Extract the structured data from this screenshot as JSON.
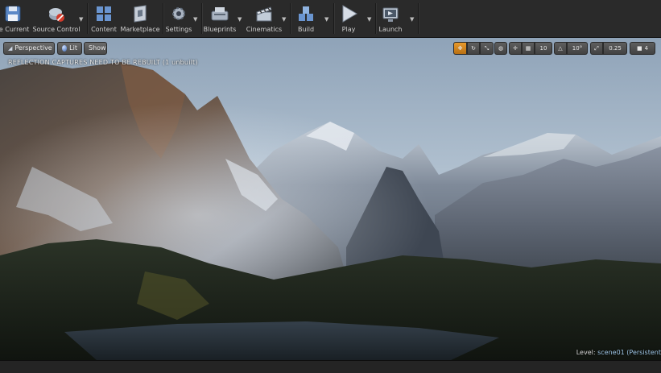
{
  "toolbar": {
    "items": [
      {
        "label": "re Current",
        "icon": "save-icon"
      },
      {
        "label": "Source Control",
        "icon": "source-control-icon"
      },
      {
        "label": "Content",
        "icon": "content-icon"
      },
      {
        "label": "Marketplace",
        "icon": "marketplace-icon"
      },
      {
        "label": "Settings",
        "icon": "settings-icon"
      },
      {
        "label": "Blueprints",
        "icon": "blueprints-icon"
      },
      {
        "label": "Cinematics",
        "icon": "cinematics-icon"
      },
      {
        "label": "Build",
        "icon": "build-icon"
      },
      {
        "label": "Play",
        "icon": "play-icon"
      },
      {
        "label": "Launch",
        "icon": "launch-icon"
      }
    ]
  },
  "viewport": {
    "view_mode": "Perspective",
    "lit_mode": "Lit",
    "show_label": "Show",
    "warning": "REFLECTION CAPTURES NEED TO BE REBUILT (1 unbuilt)",
    "snap_grid": "10",
    "snap_angle": "10°",
    "snap_scale": "0.25",
    "camera_speed": "4",
    "level_prefix": "Level:",
    "level_name": "scene01 (Persistent"
  },
  "colors": {
    "accent": "#e89a2c",
    "sky_top": "#8fa3b8",
    "sky_bottom": "#c9d5df"
  }
}
